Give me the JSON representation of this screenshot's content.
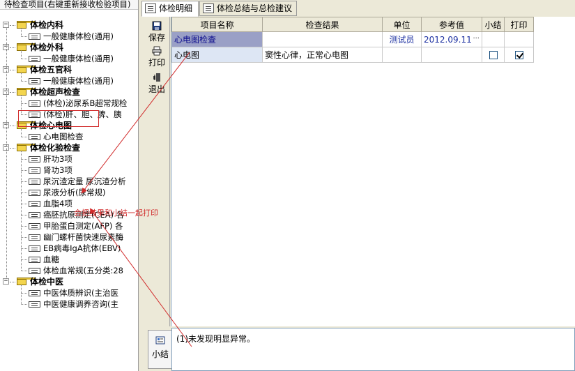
{
  "tree": {
    "title": "待检查项目(右键重新接收检验项目)",
    "groups": [
      {
        "label": "体检内科",
        "children": [
          "一般健康体检(通用)"
        ]
      },
      {
        "label": "体检外科",
        "children": [
          "一般健康体检(通用)"
        ]
      },
      {
        "label": "体检五官科",
        "children": [
          "一般健康体检(通用)"
        ]
      },
      {
        "label": "体检超声检查",
        "children": [
          "(体检)泌尿系B超常规检",
          "(体检)肝、胆、脾、胰"
        ]
      },
      {
        "label": "体检心电图",
        "children": [
          "心电图检查"
        ]
      },
      {
        "label": "体检化验检查",
        "children": [
          "肝功3项",
          "肾功3项",
          "尿沉渣定量 尿沉渣分析",
          "尿液分析(尿常规)",
          "血脂4项",
          "癌胚抗原测定(CEA) 各",
          "甲胎蛋白测定(AFP) 各",
          "幽门螺杆菌快速尿素酶",
          "EB病毒IgA抗体(EBV)",
          "血糖",
          "体检血常规(五分类:28"
        ]
      },
      {
        "label": "体检中医",
        "children": [
          "中医体质辨识(主治医",
          "中医健康调养咨询(主"
        ]
      }
    ]
  },
  "tabs": [
    {
      "label": "体检明细",
      "icon": "document-edit-icon"
    },
    {
      "label": "体检总结与总检建议",
      "icon": "folder-pen-icon"
    }
  ],
  "toolbar": {
    "save": "保存",
    "print": "打印",
    "exit": "退出"
  },
  "grid": {
    "headers": [
      "项目名称",
      "检查结果",
      "单位",
      "参考值",
      "小结",
      "打印"
    ],
    "rows": [
      {
        "name": "心电图检查",
        "result": "",
        "unit": "测试员",
        "ref": "2012.09.11",
        "summary": null,
        "print": null
      },
      {
        "name": "心电图",
        "result": "窦性心律，正常心电图",
        "unit": "",
        "ref": "",
        "summary": false,
        "print": true
      }
    ]
  },
  "summary": {
    "tab_label": "小结",
    "text": "(1)未发现明显异常。"
  },
  "annotation": {
    "text": "会把结果和小结一起打印",
    "color": "#d12b2b"
  }
}
